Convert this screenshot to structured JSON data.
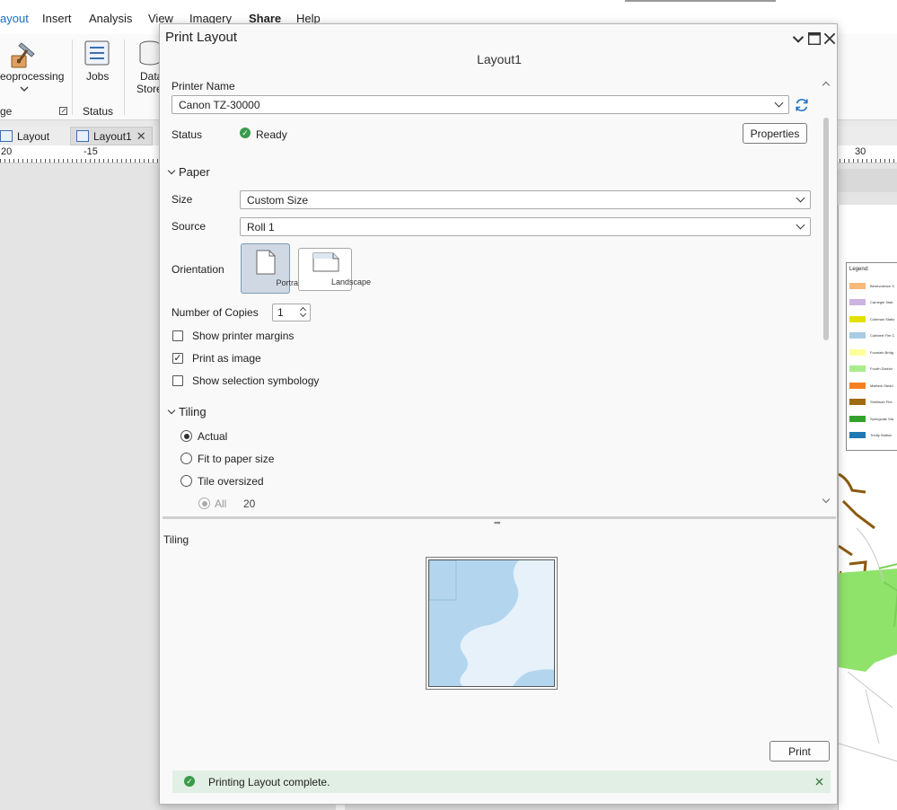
{
  "menubar": {
    "items": [
      "ayout",
      "Insert",
      "Analysis",
      "View",
      "Imagery",
      "Share",
      "Help"
    ]
  },
  "ribbon": {
    "geoprocessing_label": "eoprocessing",
    "jobs_label": "Jobs",
    "datastore_label_1": "Data",
    "datastore_label_2": "Store",
    "group_left": "ge",
    "group_status": "Status"
  },
  "doctabs": {
    "layout_tab": "Layout",
    "layout1_tab": "Layout1"
  },
  "ruler": {
    "labels": [
      "20",
      "-15",
      "30"
    ]
  },
  "legend": {
    "title": "Legend:",
    "items": [
      {
        "label": "Benevolence S",
        "color": "#f8b87a"
      },
      {
        "label": "Carnegie Stati",
        "color": "#cdb3df"
      },
      {
        "label": "Coleman Statio",
        "color": "#e2e000"
      },
      {
        "label": "Cuthbert Fire C",
        "color": "#a7cce3"
      },
      {
        "label": "Fountain Bridg",
        "color": "#ffff99"
      },
      {
        "label": "Fourth District",
        "color": "#a8ec8c"
      },
      {
        "label": "Mathew Stead",
        "color": "#f47f20"
      },
      {
        "label": "Shellman Fire",
        "color": "#a06a10"
      },
      {
        "label": "Springvale Sta",
        "color": "#33a02c"
      },
      {
        "label": "Trinity Station",
        "color": "#1f78b4"
      }
    ]
  },
  "dialog": {
    "title": "Print Layout",
    "layout_name": "Layout1",
    "printer_name_label": "Printer Name",
    "printer_value": "Canon TZ-30000",
    "status_label": "Status",
    "status_value": "Ready",
    "properties_button": "Properties",
    "paper_section": "Paper",
    "size_label": "Size",
    "size_value": "Custom Size",
    "source_label": "Source",
    "source_value": "Roll 1",
    "orientation_label": "Orientation",
    "portrait_label": "Portrait",
    "landscape_label": "Landscape",
    "copies_label": "Number of Copies",
    "copies_value": "1",
    "show_margins_label": "Show printer margins",
    "show_margins_checked": false,
    "print_as_image_label": "Print as image",
    "print_as_image_checked": true,
    "show_selection_label": "Show selection symbology",
    "show_selection_checked": false,
    "tiling_section": "Tiling",
    "tiling_options": [
      "Actual",
      "Fit to paper size",
      "Tile oversized"
    ],
    "tiling_selected": "Actual",
    "all_label": "All",
    "all_value": "20",
    "preview_label": "Tiling",
    "print_button": "Print",
    "notification": "Printing Layout complete."
  },
  "colors": {
    "accent": "#1b6ec2",
    "success": "#3a9a4c",
    "notice_bg": "#e2efe4",
    "water": "#b3d6ee"
  }
}
